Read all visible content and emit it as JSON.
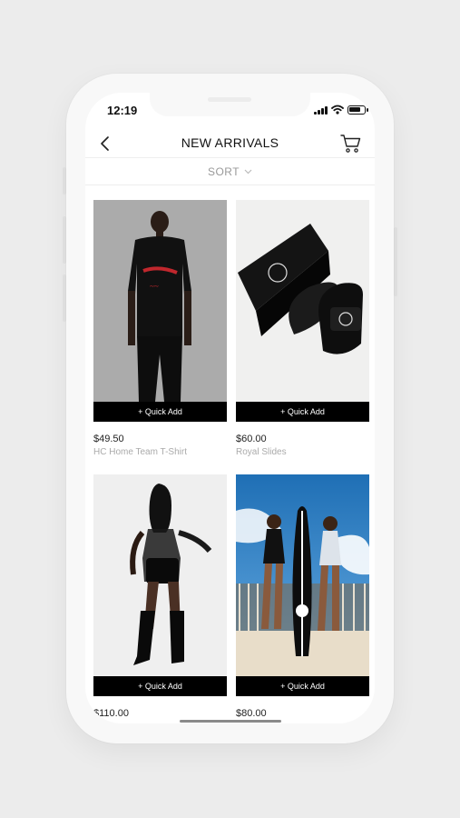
{
  "status": {
    "time": "12:19"
  },
  "header": {
    "title": "NEW ARRIVALS",
    "sort_label": "SORT"
  },
  "products": [
    {
      "price": "$49.50",
      "name": "HC Home Team T-Shirt",
      "quick_add": "+ Quick Add"
    },
    {
      "price": "$60.00",
      "name": "Royal Slides",
      "quick_add": "+ Quick Add"
    },
    {
      "price": "$110.00",
      "name": "",
      "quick_add": "+ Quick Add"
    },
    {
      "price": "$80.00",
      "name": "",
      "quick_add": "+ Quick Add"
    }
  ],
  "icons": {
    "back": "chevron-left-icon",
    "cart": "cart-icon",
    "sort": "chevron-down-icon",
    "signal": "cellular-signal-icon",
    "wifi": "wifi-icon",
    "battery": "battery-icon"
  },
  "colors": {
    "background": "#ececec",
    "phone_frame": "#f8f8f8",
    "screen": "#ffffff",
    "button": "#000000",
    "button_text": "#ffffff",
    "product_name": "#aaaaaa"
  }
}
